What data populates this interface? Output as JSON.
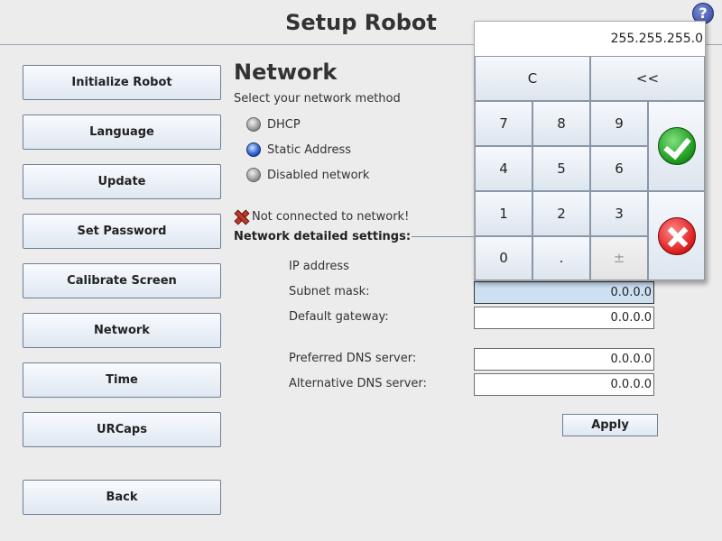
{
  "header": {
    "title": "Setup Robot",
    "help_icon": "?"
  },
  "sidebar": {
    "items": [
      {
        "label": "Initialize Robot"
      },
      {
        "label": "Language"
      },
      {
        "label": "Update"
      },
      {
        "label": "Set Password"
      },
      {
        "label": "Calibrate Screen"
      },
      {
        "label": "Network"
      },
      {
        "label": "Time"
      },
      {
        "label": "URCaps"
      }
    ],
    "back_label": "Back"
  },
  "network": {
    "heading": "Network",
    "method_prompt": "Select your network method",
    "methods": [
      {
        "label": "DHCP",
        "selected": false
      },
      {
        "label": "Static Address",
        "selected": true
      },
      {
        "label": "Disabled network",
        "selected": false
      }
    ],
    "status_text": "Not connected to network!",
    "status_icon": "x-icon",
    "details_label": "Network detailed settings:",
    "fields": [
      {
        "label": "IP address",
        "value": ""
      },
      {
        "label": "Subnet mask:",
        "value": "0.0.0.0",
        "active": true
      },
      {
        "label": "Default gateway:",
        "value": "0.0.0.0"
      },
      {
        "label": "Preferred DNS server:",
        "value": "0.0.0.0"
      },
      {
        "label": "Alternative DNS server:",
        "value": "0.0.0.0"
      }
    ],
    "apply_label": "Apply"
  },
  "keypad": {
    "display": "255.255.255.0",
    "clear_label": "C",
    "backspace_label": "<<",
    "keys": [
      "7",
      "8",
      "9",
      "4",
      "5",
      "6",
      "1",
      "2",
      "3",
      "0",
      ".",
      "±"
    ],
    "ok_icon": "checkmark-icon",
    "cancel_icon": "cancel-icon",
    "colors": {
      "ok": "#1e9a1e",
      "cancel": "#e02020",
      "active_field": "#cde0f2"
    }
  }
}
